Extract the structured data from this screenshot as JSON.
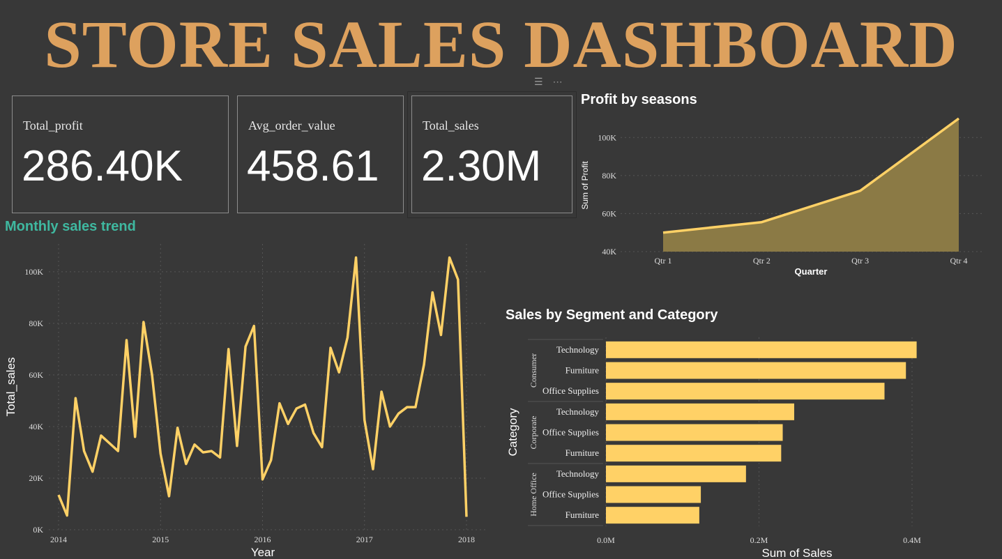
{
  "header": {
    "title": "STORE SALES DASHBOARD"
  },
  "toolbar": {
    "filter_icon": "filter-icon",
    "more_icon": "more-options-icon"
  },
  "kpis": [
    {
      "label": "Total_profit",
      "value": "286.40K"
    },
    {
      "label": "Avg_order_value",
      "value": "458.61"
    },
    {
      "label": "Total_sales",
      "value": "2.30M"
    }
  ],
  "colors": {
    "accent": "#FFD166",
    "title": "#DDA15E",
    "teal": "#3FB8A0",
    "area_fill": "#8B7A45",
    "background": "#383838"
  },
  "chart_data": [
    {
      "type": "area",
      "title": "Profit by seasons",
      "xlabel": "Quarter",
      "ylabel": "Sum of Profit",
      "categories": [
        "Qtr 1",
        "Qtr 2",
        "Qtr 3",
        "Qtr 4"
      ],
      "values": [
        50000,
        55500,
        72000,
        110000
      ],
      "ylim": [
        40000,
        110000
      ],
      "yticks": [
        "40K",
        "60K",
        "80K",
        "100K"
      ],
      "ytick_values": [
        40000,
        60000,
        80000,
        100000
      ],
      "grid": true
    },
    {
      "type": "line",
      "title": "Monthly sales trend",
      "xlabel": "Year",
      "ylabel": "Total_sales",
      "x_start_year": 2014,
      "values": [
        13500,
        5500,
        51000,
        30500,
        22500,
        36500,
        33500,
        30500,
        73500,
        36000,
        80500,
        60000,
        29500,
        13000,
        39500,
        25500,
        33000,
        30000,
        30500,
        28000,
        70000,
        32500,
        71000,
        79000,
        19500,
        27000,
        49000,
        41000,
        47000,
        48500,
        37500,
        32000,
        70500,
        61000,
        74500,
        105500,
        42500,
        23500,
        53500,
        40000,
        45000,
        47500,
        47500,
        64000,
        92000,
        75500,
        105500,
        97000,
        5000
      ],
      "ylim": [
        0,
        105500
      ],
      "yticks": [
        "0K",
        "20K",
        "40K",
        "60K",
        "80K",
        "100K"
      ],
      "ytick_values": [
        0,
        20000,
        40000,
        60000,
        80000,
        100000
      ],
      "xticks": [
        "2014",
        "2015",
        "2016",
        "2017",
        "2018"
      ],
      "grid": true
    },
    {
      "type": "bar",
      "orientation": "horizontal",
      "title": "Sales by Segment and Category",
      "xlabel": "Sum of Sales",
      "ylabel": "Category",
      "groups": [
        {
          "name": "Consumer",
          "categories": [
            "Technology",
            "Furniture",
            "Office Supplies"
          ],
          "values": [
            0.406,
            0.392,
            0.364
          ]
        },
        {
          "name": "Corporate",
          "categories": [
            "Technology",
            "Office Supplies",
            "Furniture"
          ],
          "values": [
            0.246,
            0.231,
            0.229
          ]
        },
        {
          "name": "Home Office",
          "categories": [
            "Technology",
            "Office Supplies",
            "Furniture"
          ],
          "values": [
            0.183,
            0.124,
            0.122
          ]
        }
      ],
      "xlim": [
        0,
        0.4
      ],
      "xticks": [
        "0.0M",
        "0.2M",
        "0.4M"
      ],
      "xtick_values": [
        0,
        0.2,
        0.4
      ],
      "grid": true
    }
  ]
}
